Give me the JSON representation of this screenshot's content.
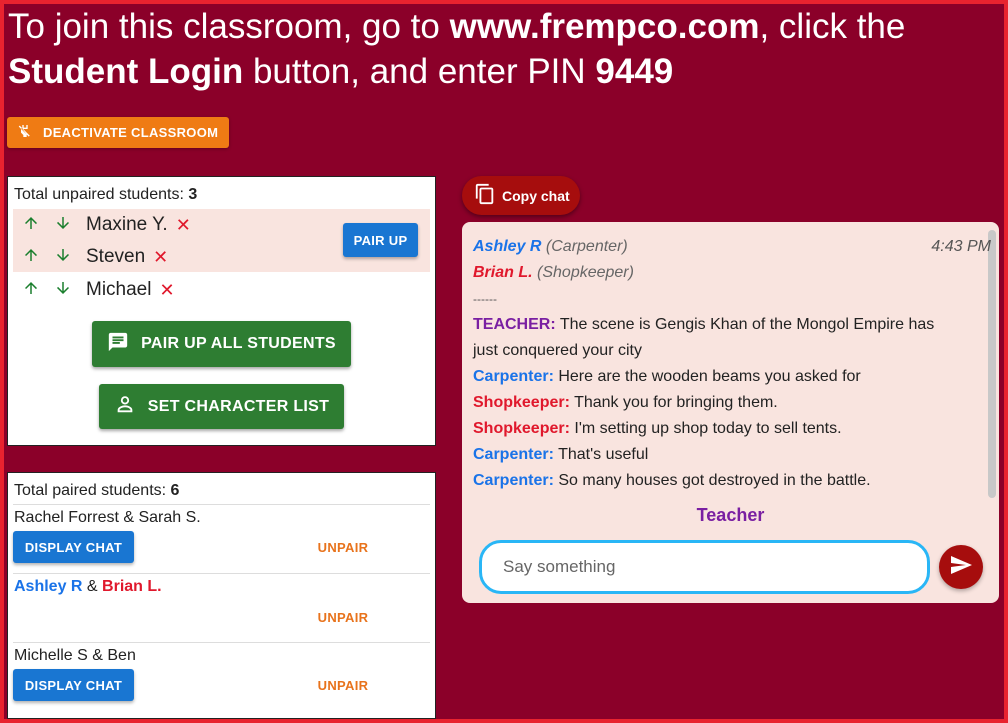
{
  "header": {
    "text_1": "To join this classroom, go to ",
    "site": "www.frempco.com",
    "text_2": ", click the ",
    "button_name": "Student Login",
    "text_3": " button, and enter PIN ",
    "pin": "9449"
  },
  "deactivate": {
    "label": "DEACTIVATE CLASSROOM",
    "icon": "power-off-icon"
  },
  "unpaired": {
    "title": "Total unpaired students: ",
    "count": "3",
    "students": [
      {
        "name": "Maxine Y."
      },
      {
        "name": "Steven"
      },
      {
        "name": "Michael"
      }
    ],
    "remove_glyph": "✕",
    "pair_up_label": "PAIR UP",
    "pair_all_label": "PAIR UP ALL STUDENTS",
    "character_list_label": "SET CHARACTER LIST"
  },
  "paired": {
    "title": "Total paired students: ",
    "count": "6",
    "pairs": [
      {
        "a": "Rachel Forrest",
        "sep": " & ",
        "b": "Sarah S.",
        "display_chat": "DISPLAY CHAT",
        "unpair": "UNPAIR"
      },
      {
        "a": "Ashley R",
        "sep": " & ",
        "b": "Brian L.",
        "unpair": "UNPAIR"
      },
      {
        "a": "Michelle S",
        "sep": " & ",
        "b": "Ben",
        "display_chat": "DISPLAY CHAT",
        "unpair": "UNPAIR"
      }
    ]
  },
  "copy_chat": {
    "label": "Copy chat"
  },
  "chat": {
    "student_a": {
      "name": "Ashley R",
      "role": "(Carpenter)"
    },
    "student_b": {
      "name": "Brian L.",
      "role": "(Shopkeeper)"
    },
    "time": "4:43 PM",
    "separator": "------",
    "messages": [
      {
        "speaker": "TEACHER:",
        "text": " The scene is Gengis Khan of the Mongol Empire has",
        "text_cont": "just conquered your city"
      },
      {
        "speaker": "Carpenter:",
        "text": " Here are the wooden beams you asked for"
      },
      {
        "speaker": "Shopkeeper:",
        "text": " Thank you for bringing them."
      },
      {
        "speaker": "Shopkeeper:",
        "text": " I'm setting up shop today to sell tents."
      },
      {
        "speaker": "Carpenter:",
        "text": " That's useful"
      },
      {
        "speaker": "Carpenter:",
        "text": " So many houses got destroyed in the battle."
      }
    ],
    "speaker_label": "Teacher",
    "input_placeholder": "Say something"
  },
  "colors": {
    "background": "#8b0029",
    "orange": "#ef7b14",
    "blue": "#1976d2",
    "green": "#2e7d32",
    "purple": "#7a1fa2",
    "red_name": "#e0182c"
  }
}
